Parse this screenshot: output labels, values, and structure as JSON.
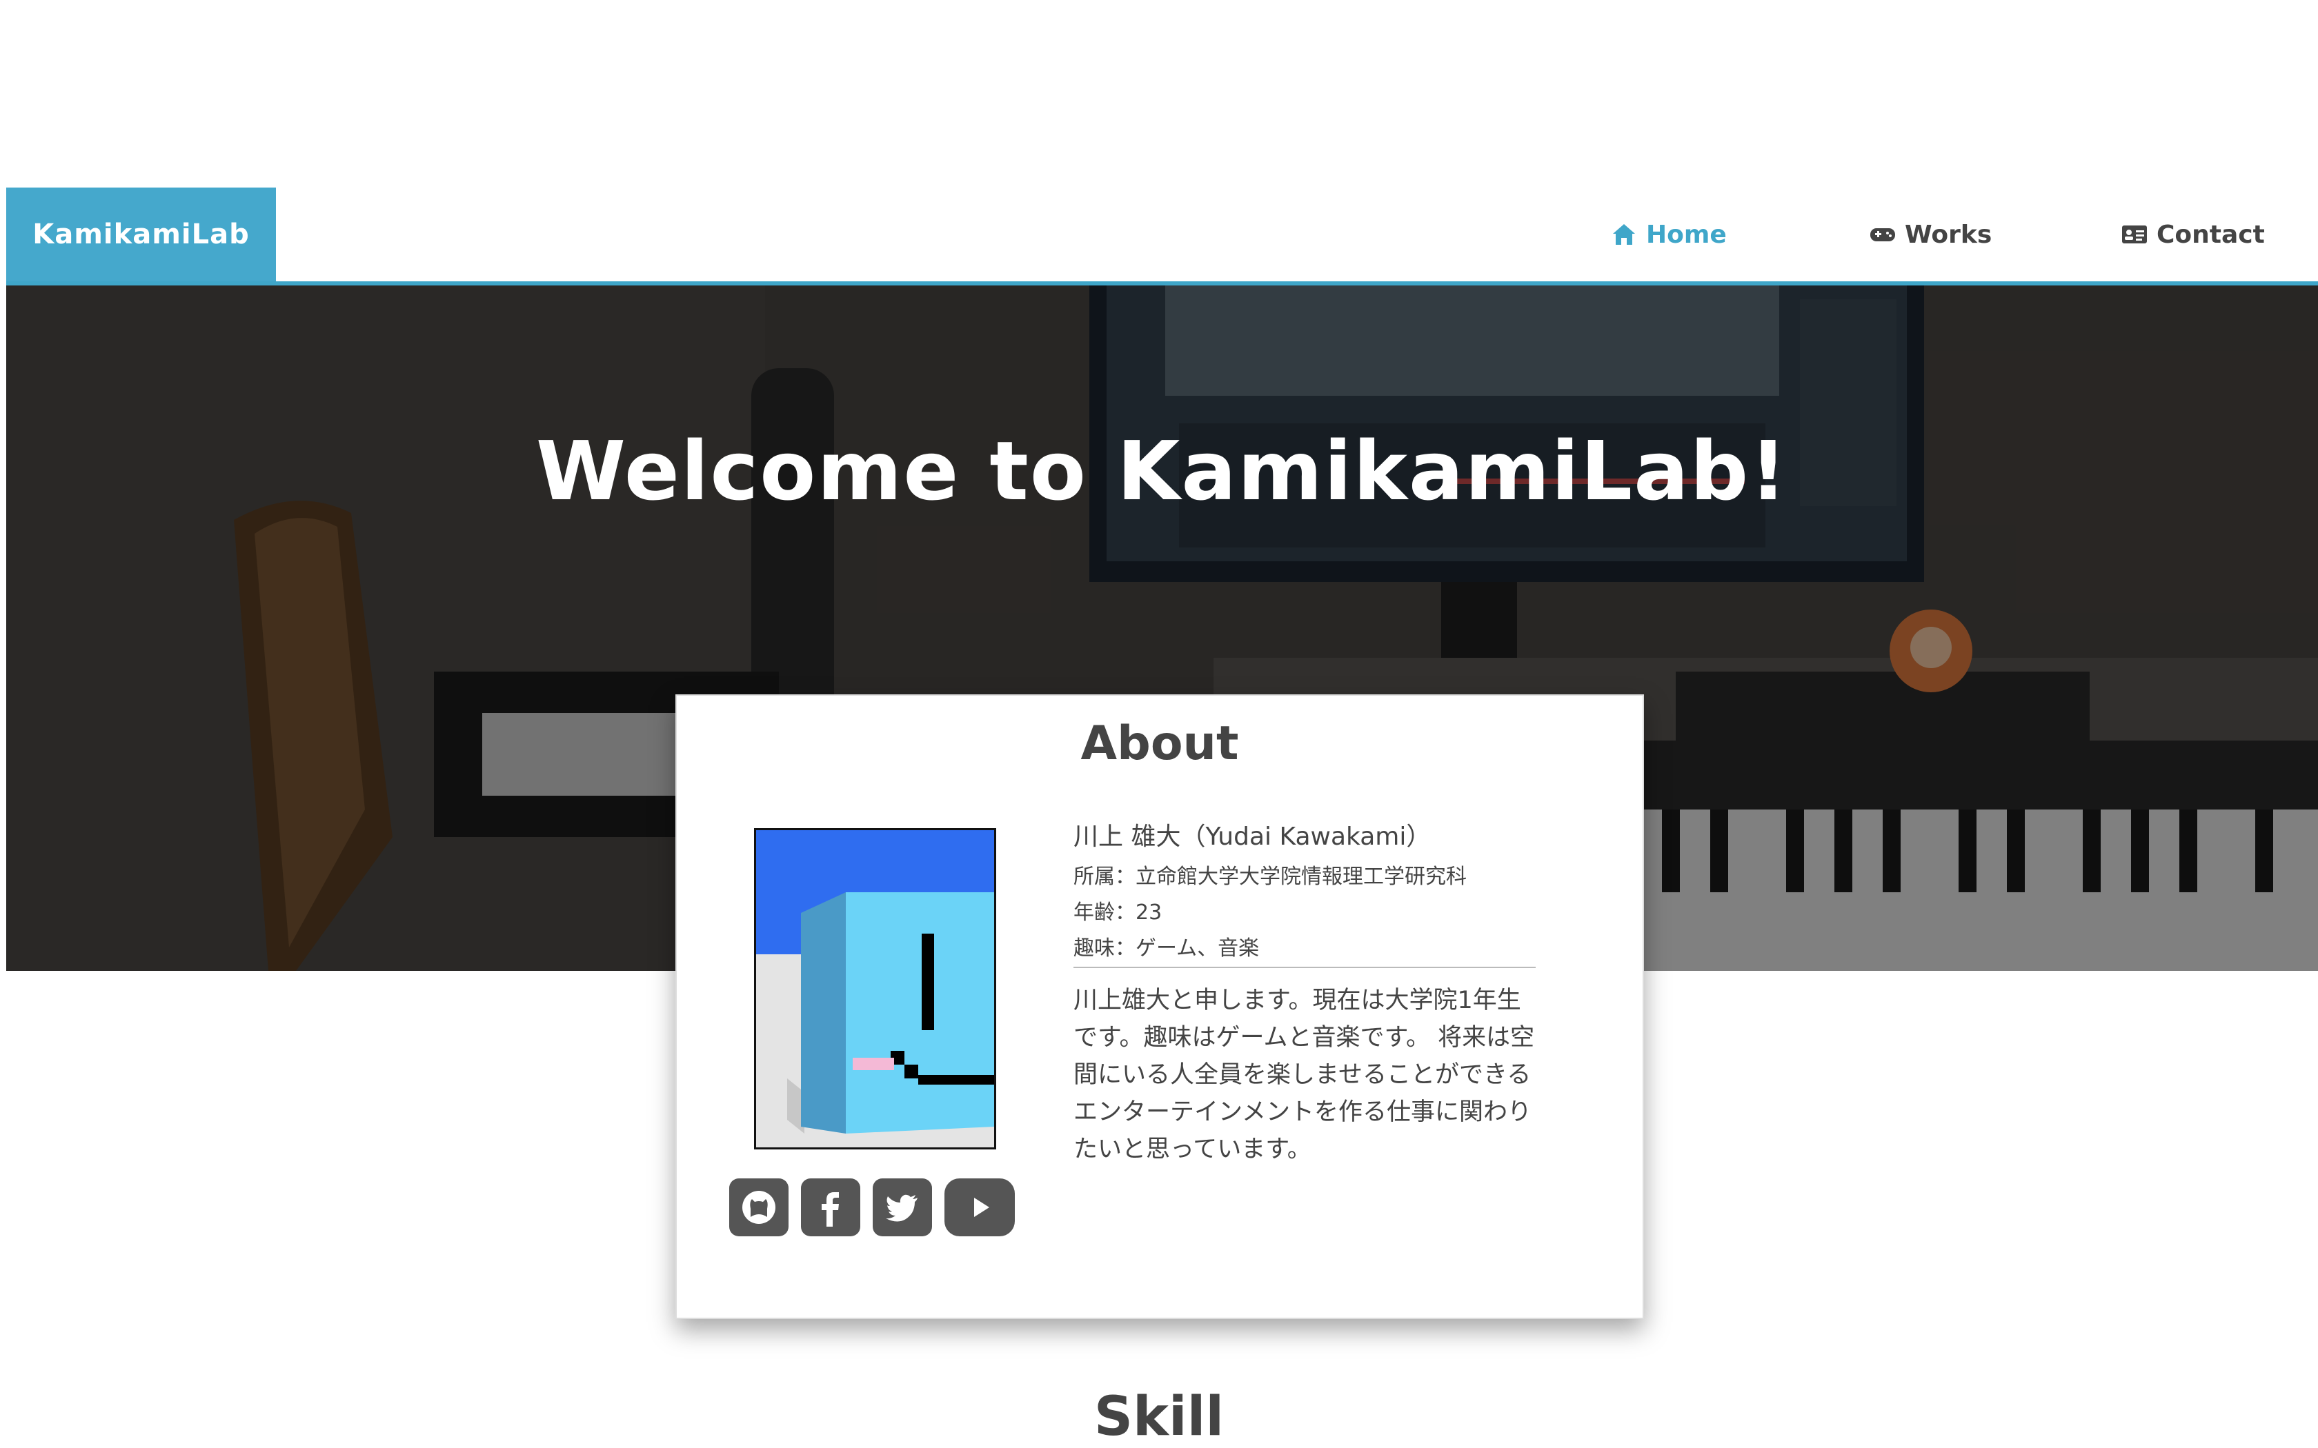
{
  "nav": {
    "brand": "KamikamiLab",
    "items": [
      {
        "label": "Home",
        "icon": "home-icon",
        "active": true
      },
      {
        "label": "Works",
        "icon": "gamepad-icon",
        "active": false
      },
      {
        "label": "Contact",
        "icon": "contact-card-icon",
        "active": false
      }
    ]
  },
  "hero": {
    "title": "Welcome to KamikamiLab!"
  },
  "about": {
    "title": "About",
    "name": "川上 雄大（Yudai Kawakami）",
    "affiliation": "所属：立命館大学大学院情報理工学研究科",
    "age": "年齢：23",
    "hobby": "趣味：ゲーム、音楽",
    "bio": "川上雄大と申します。現在は大学院1年生です。趣味はゲームと音楽です。 将来は空間にいる人全員を楽しませることができるエンターテインメントを作る仕事に関わりたいと思っています。",
    "socials": [
      "github-icon",
      "facebook-icon",
      "twitter-icon",
      "youtube-icon"
    ]
  },
  "skill": {
    "title": "Skill"
  },
  "colors": {
    "accent": "#45a8cc",
    "text": "#444444"
  }
}
